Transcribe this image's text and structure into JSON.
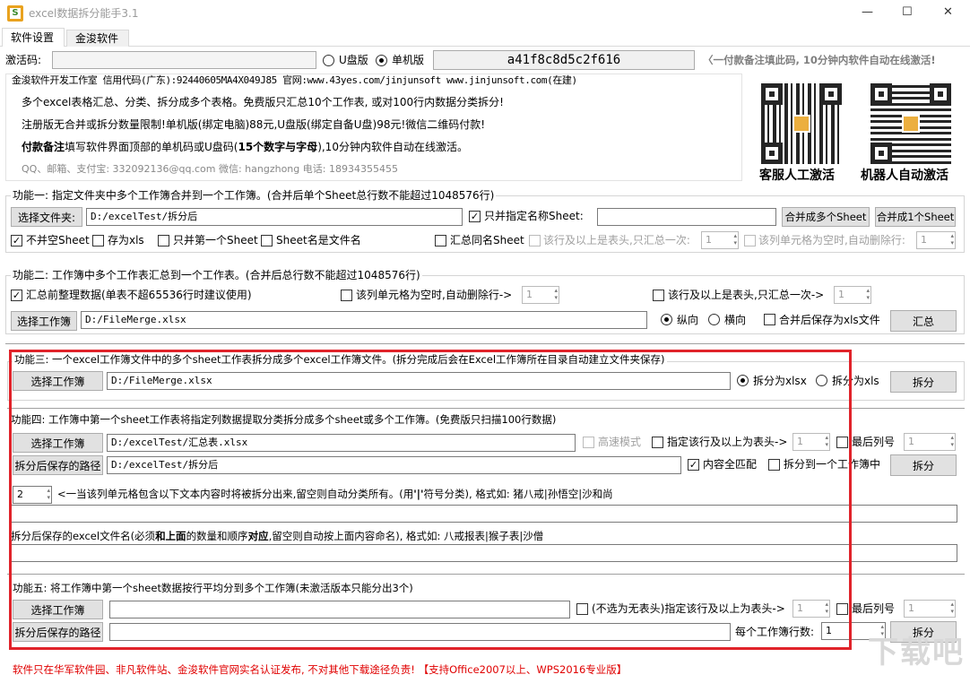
{
  "window": {
    "title": "excel数据拆分能手3.1",
    "controls": {
      "minimize": "—",
      "maximize": "☐",
      "close": "✕"
    }
  },
  "tabs": [
    {
      "label": "软件设置"
    },
    {
      "label": "金浚软件"
    }
  ],
  "activation": {
    "label": "激活码:",
    "value": "",
    "udisk_label": "U盘版",
    "standalone_label": "单机版",
    "machine_code": "a41f8c8d5c2f616",
    "hint": "〈一付款备注填此码, 10分钟内软件自动在线激活!"
  },
  "info": {
    "line1": "金浚软件开发工作室 信用代码(广东):92440605MA4X049J85 官网:www.43yes.com/jinjunsoft  www.jinjunsoft.com(在建)",
    "line2": "多个excel表格汇总、分类、拆分成多个表格。免费版只汇总10个工作表, 或对100行内数据分类拆分!",
    "line3": "注册版无合并或拆分数量限制!单机版(绑定电脑)88元,U盘版(绑定自备U盘)98元!微信二维码付款!",
    "line4a": "付款备注",
    "line4b": "填写软件界面顶部的单机码或U盘码(",
    "line4c": "15个数字与字母",
    "line4d": "),10分钟内软件自动在线激活。",
    "line5": "QQ、邮箱、支付宝: 332092136@qq.com   微信: hangzhong   电话: 18934355455",
    "qr1_label": "客服人工激活",
    "qr2_label": "机器人自动激活"
  },
  "f1": {
    "title": "功能一: 指定文件夹中多个工作簿合并到一个工作簿。(合并后单个Sheet总行数不能超过1048576行)",
    "choose_folder": "选择文件夹:",
    "folder_path": "D:/excelTest/拆分后",
    "only_sheet": "只并指定名称Sheet:",
    "sheet_name": "",
    "merge_many": "合并成多个Sheet",
    "merge_one": "合并成1个Sheet",
    "no_empty": "不并空Sheet",
    "save_xls": "存为xls",
    "only_first": "只并第一个Sheet",
    "sheet_is_file": "Sheet名是文件名",
    "same_name": "汇总同名Sheet",
    "header_rows": "该行及以上是表头,只汇总一次:",
    "header_val": "1",
    "empty_del": "该列单元格为空时,自动删除行:",
    "empty_val": "1"
  },
  "f2": {
    "title": "功能二: 工作簿中多个工作表汇总到一个工作表。(合并后总行数不能超过1048576行)",
    "tidy": "汇总前整理数据(单表不超65536行时建议使用)",
    "col_empty": "该列单元格为空时,自动删除行->",
    "col_val": "1",
    "header": "该行及以上是表头,只汇总一次->",
    "header_val": "1",
    "choose": "选择工作簿",
    "path": "D:/FileMerge.xlsx",
    "vertical": "纵向",
    "horizontal": "横向",
    "save_xls": "合并后保存为xls文件",
    "btn": "汇总"
  },
  "f3": {
    "title": "功能三: 一个excel工作簿文件中的多个sheet工作表拆分成多个excel工作簿文件。(拆分完成后会在Excel工作簿所在目录自动建立文件夹保存)",
    "choose": "选择工作簿",
    "path": "D:/FileMerge.xlsx",
    "xlsx": "拆分为xlsx",
    "xls": "拆分为xls",
    "btn": "拆分"
  },
  "f4": {
    "title": "功能四: 工作簿中第一个sheet工作表将指定列数据提取分类拆分成多个sheet或多个工作簿。(免费版只扫描100行数据)",
    "choose": "选择工作簿",
    "path": "D:/excelTest/汇总表.xlsx",
    "fast": "高速模式",
    "header": "指定该行及以上为表头->",
    "header_val": "1",
    "last_col": "最后列号",
    "last_val": "1",
    "save_path_btn": "拆分后保存的路径",
    "save_path": "D:/excelTest/拆分后",
    "full_match": "内容全匹配",
    "to_one": "拆分到一个工作簿中",
    "btn": "拆分",
    "col_val": "2",
    "note1": "<一当该列单元格包含以下文本内容时将被拆分出来,留空则自动分类所有。(用",
    "note1b": "'|'",
    "note1c": "符号分类), 格式如: 猪八戒|孙悟空|沙和尚",
    "text1": "",
    "note2a": "拆分后保存的excel文件名(必须",
    "note2b": "和上面",
    "note2c": "的数量和顺序",
    "note2d": "对应",
    "note2e": ",留空则自动按上面内容命名), 格式如: 八戒报表|猴子表|沙僧",
    "text2": ""
  },
  "f5": {
    "title": "功能五: 将工作簿中第一个sheet数据按行平均分到多个工作簿(未激活版本只能分出3个)",
    "choose": "选择工作簿",
    "path": "",
    "no_header": "(不选为无表头)指定该行及以上为表头->",
    "header_val": "1",
    "last_col": "最后列号",
    "last_val": "1",
    "save_path_btn": "拆分后保存的路径",
    "save_path": "",
    "rows_per": "每个工作簿行数:",
    "rows_val": "1",
    "btn": "拆分"
  },
  "footer": "软件只在华军软件园、非凡软件站、金浚软件官网实名认证发布, 不对其他下载途径负责! 【支持Office2007以上、WPS2016专业版】",
  "watermark": "下载吧",
  "colors": {
    "highlight_box": "#e0232a",
    "footer_red": "#e00000",
    "hint_gray": "#7f7f7f"
  }
}
